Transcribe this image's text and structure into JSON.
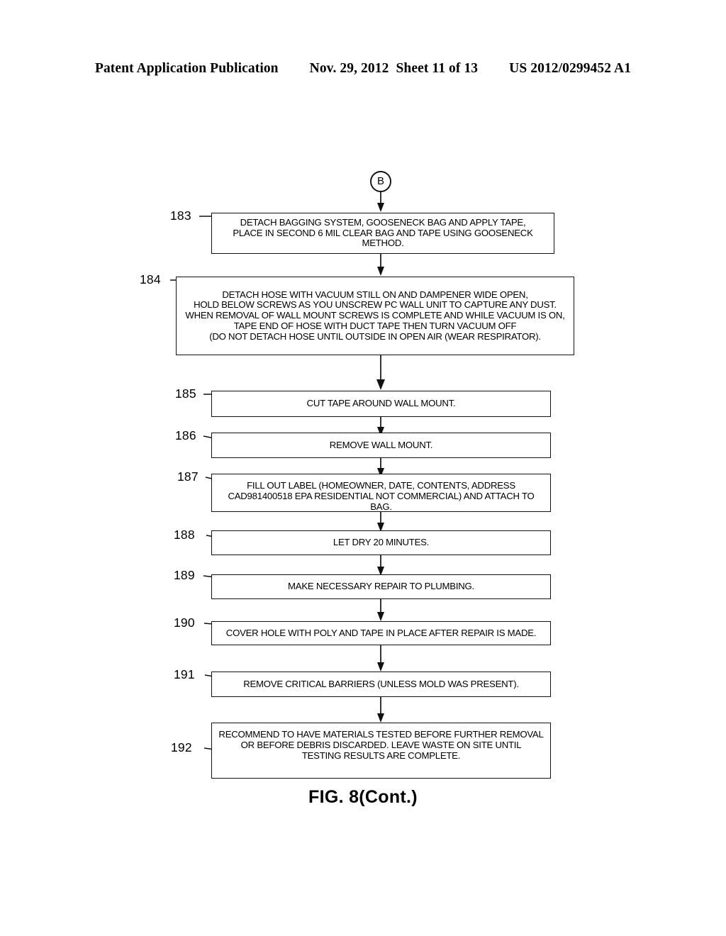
{
  "header": {
    "publication": "Patent Application Publication",
    "date": "Nov. 29, 2012",
    "sheet": "Sheet 11 of 13",
    "patent_number": "US 2012/0299452 A1"
  },
  "figure": {
    "caption": "FIG. 8(Cont.)",
    "connector_in": "B"
  },
  "flowchart": {
    "nodes": [
      {
        "ref": "183",
        "text": "DETACH BAGGING SYSTEM, GOOSENECK BAG AND APPLY TAPE,\nPLACE IN SECOND 6 MIL CLEAR BAG AND TAPE USING GOOSENECK METHOD."
      },
      {
        "ref": "184",
        "text": "DETACH HOSE WITH VACUUM STILL ON AND DAMPENER WIDE OPEN,\nHOLD BELOW SCREWS AS YOU UNSCREW PC WALL UNIT TO CAPTURE ANY DUST.\nWHEN REMOVAL OF WALL MOUNT SCREWS IS COMPLETE AND WHILE VACUUM IS ON,\nTAPE END OF HOSE WITH DUCT TAPE THEN TURN VACUUM OFF\n(DO NOT DETACH HOSE UNTIL OUTSIDE IN OPEN AIR (WEAR RESPIRATOR)."
      },
      {
        "ref": "185",
        "text": "CUT TAPE AROUND WALL MOUNT."
      },
      {
        "ref": "186",
        "text": "REMOVE WALL MOUNT."
      },
      {
        "ref": "187",
        "text": "FILL OUT LABEL (HOMEOWNER, DATE, CONTENTS, ADDRESS\nCAD981400518 EPA RESIDENTIAL NOT COMMERCIAL) AND ATTACH TO BAG."
      },
      {
        "ref": "188",
        "text": "LET DRY 20 MINUTES."
      },
      {
        "ref": "189",
        "text": "MAKE NECESSARY REPAIR TO PLUMBING."
      },
      {
        "ref": "190",
        "text": "COVER HOLE WITH POLY AND TAPE IN PLACE AFTER REPAIR IS MADE."
      },
      {
        "ref": "191",
        "text": "REMOVE CRITICAL BARRIERS (UNLESS MOLD WAS PRESENT)."
      },
      {
        "ref": "192",
        "text": "RECOMMEND TO HAVE MATERIALS TESTED BEFORE FURTHER REMOVAL\nOR BEFORE DEBRIS DISCARDED. LEAVE WASTE ON SITE UNTIL\nTESTING RESULTS ARE COMPLETE."
      }
    ]
  },
  "colors": {
    "ink": "#111111",
    "paper": "#ffffff"
  }
}
